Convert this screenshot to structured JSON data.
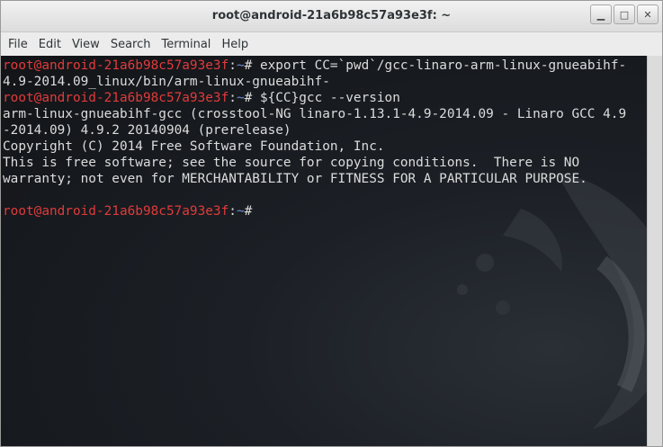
{
  "window": {
    "title": "root@android-21a6b98c57a93e3f: ~",
    "controls": {
      "minimize": "▁",
      "maximize": "□",
      "close": "✕"
    }
  },
  "menu": [
    "File",
    "Edit",
    "View",
    "Search",
    "Terminal",
    "Help"
  ],
  "terminal": {
    "prompt_user": "root@android-21a6b98c57a93e3f",
    "prompt_sep": ":",
    "prompt_path": "~",
    "prompt_suffix": "# ",
    "lines": [
      {
        "type": "prompt",
        "text": "export CC=`pwd`/gcc-linaro-arm-linux-gnueabihf-"
      },
      {
        "type": "output",
        "text": "4.9-2014.09_linux/bin/arm-linux-gnueabihf-"
      },
      {
        "type": "prompt",
        "text": "${CC}gcc --version"
      },
      {
        "type": "output",
        "text": "arm-linux-gnueabihf-gcc (crosstool-NG linaro-1.13.1-4.9-2014.09 - Linaro GCC 4.9"
      },
      {
        "type": "output",
        "text": "-2014.09) 4.9.2 20140904 (prerelease)"
      },
      {
        "type": "output",
        "text": "Copyright (C) 2014 Free Software Foundation, Inc."
      },
      {
        "type": "output",
        "text": "This is free software; see the source for copying conditions.  There is NO"
      },
      {
        "type": "output",
        "text": "warranty; not even for MERCHANTABILITY or FITNESS FOR A PARTICULAR PURPOSE."
      },
      {
        "type": "output",
        "text": ""
      },
      {
        "type": "prompt",
        "text": ""
      }
    ]
  },
  "colors": {
    "prompt_user": "#e03b3b",
    "prompt_path": "#6b8fd6",
    "text": "#dcdcdc",
    "background": "#161a1e"
  }
}
